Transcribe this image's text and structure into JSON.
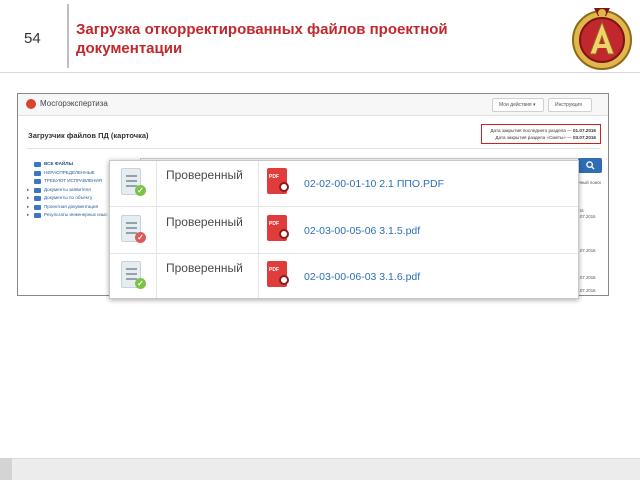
{
  "slide": {
    "number": "54",
    "title": "Загрузка откорректированных файлов проектной документации"
  },
  "app": {
    "name": "Мосгорэкспертиза",
    "my_actions": "Мои действия ▾",
    "instructions": "Инструкция",
    "page_heading": "Загрузчик файлов ПД (карточка)",
    "deadlines": [
      {
        "label": "Дата закрытия последнего раздела —",
        "date": "01.07.2016"
      },
      {
        "label": "Дата закрытия раздела «Сметы» —",
        "date": "03.07.2016"
      }
    ],
    "sidebar": [
      {
        "label": "ВСЕ ФАЙЛЫ",
        "caret": "",
        "bold": true
      },
      {
        "label": "НЕРАСПРЕДЕЛЕННЫЕ",
        "caret": "",
        "bold": false
      },
      {
        "label": "ТРЕБУЮТ ИСПРАВЛЕНИЯ",
        "caret": "",
        "bold": false
      },
      {
        "label": "Документы заявителя",
        "caret": "▸",
        "bold": false
      },
      {
        "label": "Документы по объекту",
        "caret": "▸",
        "bold": false
      },
      {
        "label": "Проектная документация",
        "caret": "▸",
        "bold": false
      },
      {
        "label": "Результаты инженерных изыс",
        "caret": "▸",
        "bold": false
      }
    ],
    "search_icon": "search-icon",
    "right_column": [
      "Точный поиск",
      "Дата",
      "03.07.2016",
      "03.07.2016",
      "03.07.2016",
      "03.07.2016"
    ]
  },
  "files": [
    {
      "status": "Проверенный",
      "file": "02-02-00-01-10 2.1 ППО.PDF",
      "check": "ok",
      "check_color": "#7cc34a"
    },
    {
      "status": "Проверенный",
      "file": "02-03-00-05-06 3.1.5.pdf",
      "check": "error",
      "check_color": "#e05a5a"
    },
    {
      "status": "Проверенный",
      "file": "02-03-00-06-03 3.1.6.pdf",
      "check": "ok",
      "check_color": "#7cc34a"
    }
  ],
  "pdf_tag": "PDF",
  "colors": {
    "title": "#c0282d",
    "link": "#2d6fb8",
    "accent": "#2f6db5",
    "highlight": "#d21f1f"
  }
}
